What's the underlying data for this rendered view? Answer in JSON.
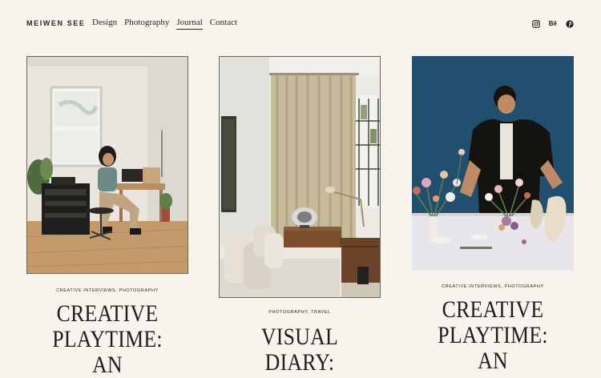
{
  "header": {
    "brand": "MEIWEN SEE",
    "nav": [
      {
        "label": "Design",
        "active": false
      },
      {
        "label": "Photography",
        "active": false
      },
      {
        "label": "Journal",
        "active": true
      },
      {
        "label": "Contact",
        "active": false
      }
    ],
    "social": [
      {
        "icon": "instagram-icon"
      },
      {
        "icon": "behance-icon",
        "label": "Bē"
      },
      {
        "icon": "pinterest-icon"
      }
    ]
  },
  "posts": [
    {
      "categories": "CREATIVE INTERVIEWS, PHOTOGRAPHY",
      "title": "CREATIVE\nPLAYTIME: AN",
      "image": "woman-in-studio-photo"
    },
    {
      "categories": "PHOTOGRAPHY, TRAVEL",
      "title": "VISUAL DIARY:",
      "image": "bedroom-interior-photo"
    },
    {
      "categories": "CREATIVE INTERVIEWS, PHOTOGRAPHY",
      "title": "CREATIVE\nPLAYTIME: AN",
      "image": "florist-arranging-photo"
    }
  ],
  "colors": {
    "background": "#f7f4ee",
    "text": "#1f1d1a",
    "accent_blue": "#1f4d6b"
  }
}
